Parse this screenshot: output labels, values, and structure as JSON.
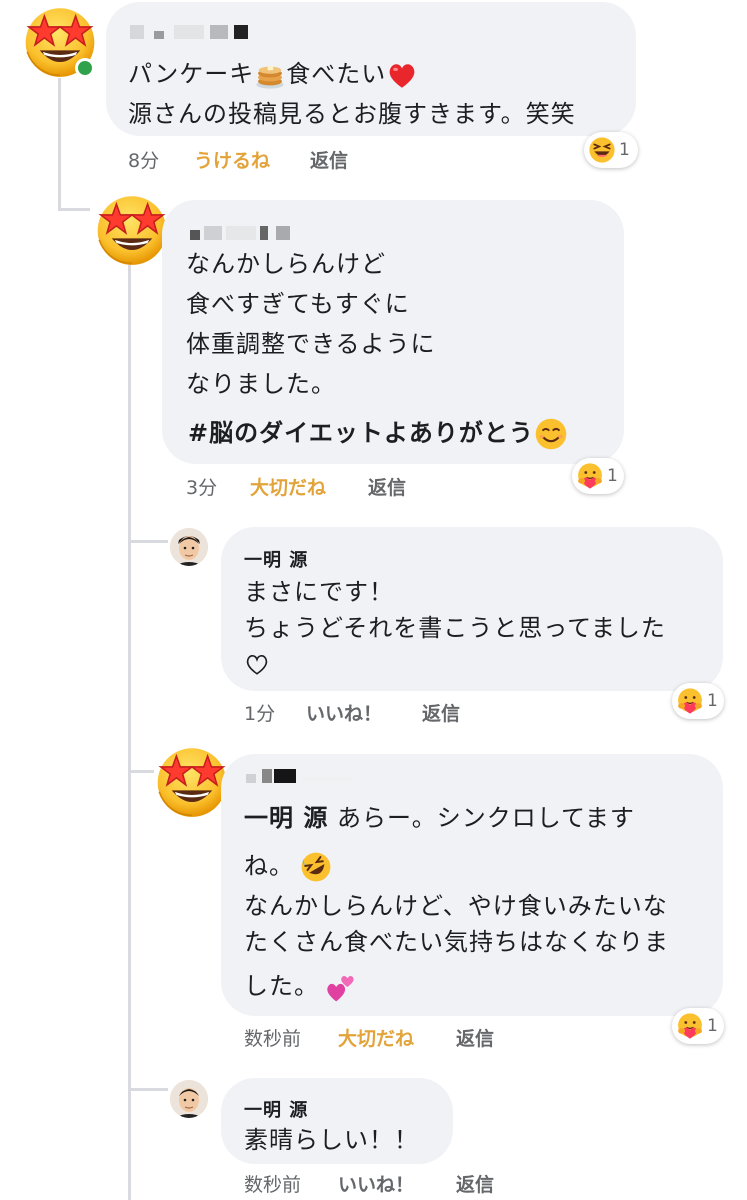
{
  "comments": [
    {
      "text_lines": [
        "パンケーキ",
        "源さんの投稿見るとお腹すきます。笑笑"
      ],
      "line1_tail": "食べたい",
      "time": "8分",
      "reaction_label": "うけるね",
      "reply_label": "返信",
      "reaction_count": "1",
      "reaction_icon": "laughing-emoji-icon"
    },
    {
      "text_lines": [
        "なんかしらんけど",
        "食べすぎてもすぐに",
        "体重調整できるように",
        "なりました。"
      ],
      "hashtag": "#脳のダイエットよありがとう",
      "time": "3分",
      "reaction_label": "大切だね",
      "reply_label": "返信",
      "reaction_count": "1",
      "reaction_icon": "care-emoji-icon"
    },
    {
      "author": "一明 源",
      "text_lines": [
        "まさにです！",
        "ちょうどそれを書こうと思ってました"
      ],
      "time": "1分",
      "reaction_label": "いいね！",
      "reply_label": "返信",
      "reaction_count": "1",
      "reaction_icon": "care-emoji-icon"
    },
    {
      "mention": "一明 源",
      "line1_rest": "あらー。シンクロしてます",
      "text_lines": [
        "ね。",
        "なんかしらんけど、やけ食いみたいな",
        "たくさん食べたい気持ちはなくなりま",
        "した。"
      ],
      "time": "数秒前",
      "reaction_label": "大切だね",
      "reply_label": "返信",
      "reaction_count": "1",
      "reaction_icon": "care-emoji-icon"
    },
    {
      "author": "一明 源",
      "text_lines": [
        "素晴らしい！！"
      ],
      "time": "数秒前",
      "reaction_label": "いいね！",
      "reply_label": "返信"
    }
  ],
  "colors": {
    "bubble": "#f0f2f5",
    "meta_text": "#65676b",
    "reaction_gold": "#e2a43a",
    "thread_line": "#d8dadf",
    "online_dot": "#31a24c"
  }
}
